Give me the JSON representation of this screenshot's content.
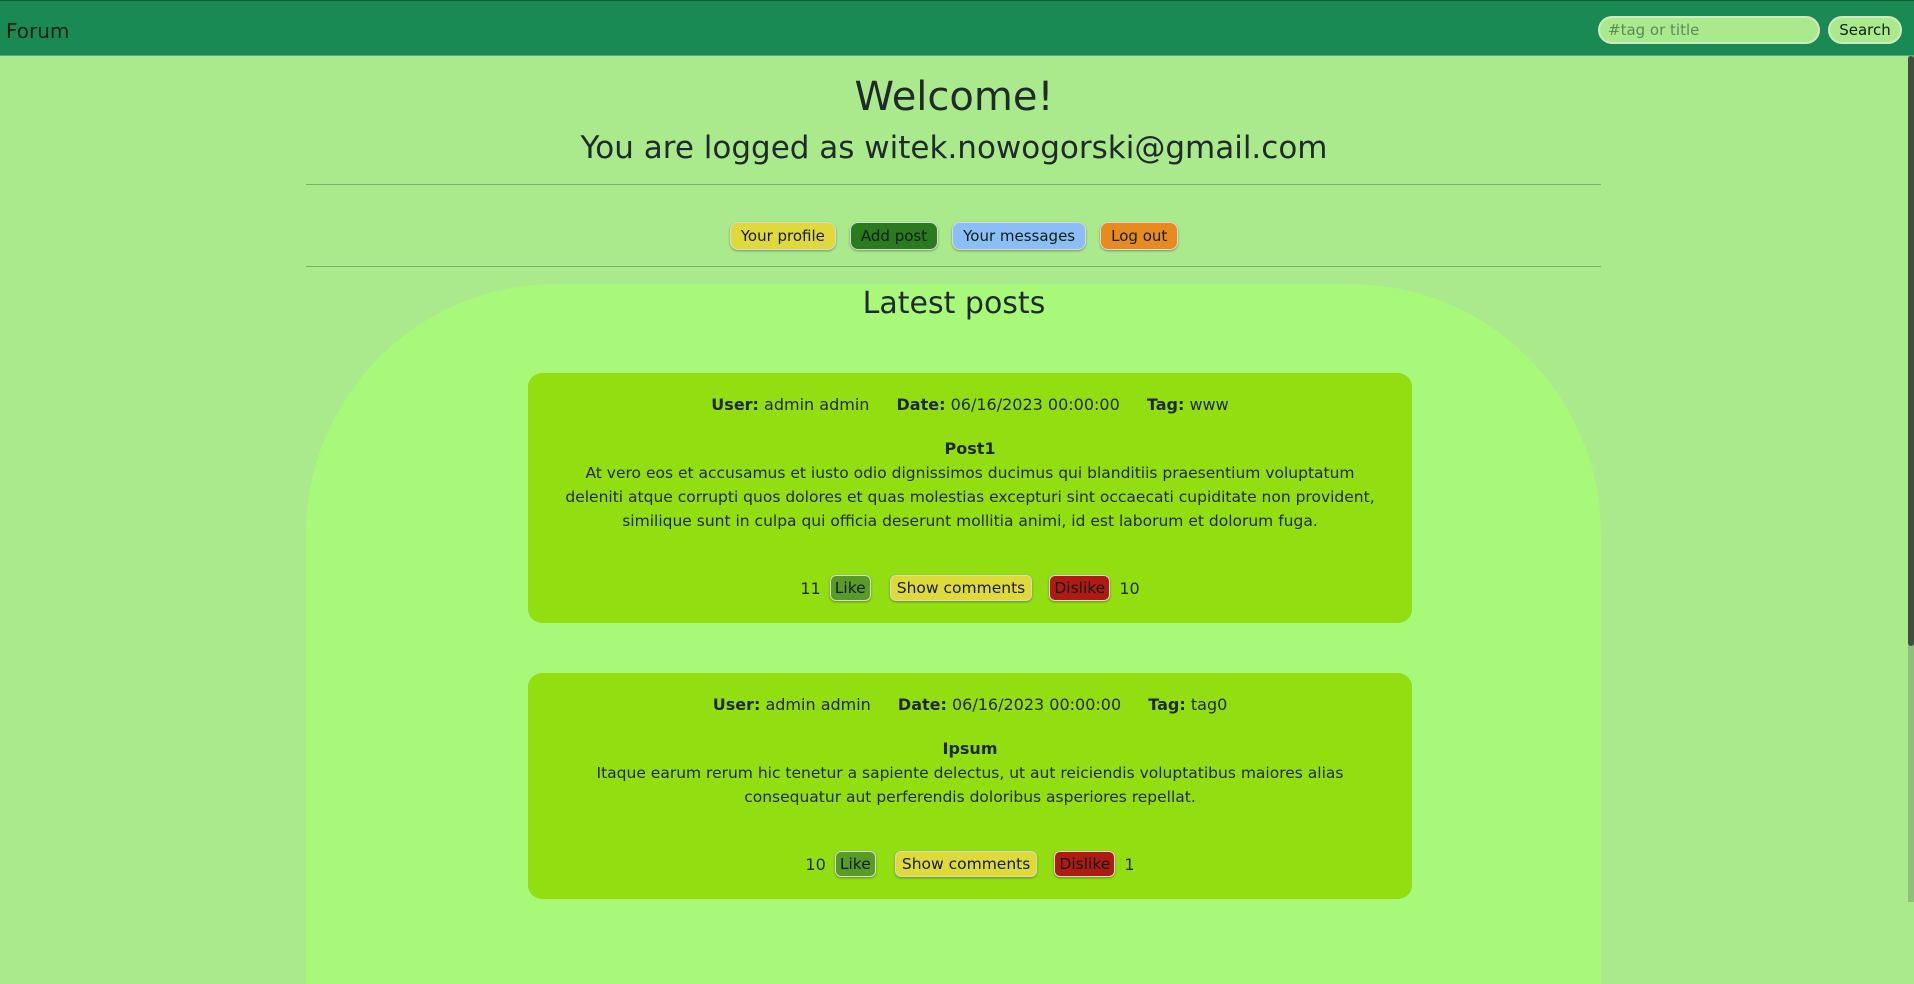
{
  "header": {
    "brand": "Forum",
    "search_placeholder": "#tag or title",
    "search_label": "Search"
  },
  "welcome": {
    "title": "Welcome!",
    "logged_as": "You are logged as witek.nowogorski@gmail.com"
  },
  "nav": {
    "profile": "Your profile",
    "add_post": "Add post",
    "messages": "Your messages",
    "logout": "Log out"
  },
  "latest_title": "Latest posts",
  "labels": {
    "user": "User:",
    "date": "Date:",
    "tag": "Tag:",
    "like": "Like",
    "show_comments": "Show comments",
    "dislike": "Dislike"
  },
  "posts": [
    {
      "user": "admin admin",
      "date": "06/16/2023 00:00:00",
      "tag": "www",
      "title": "Post1",
      "body": "At vero eos et accusamus et iusto odio dignissimos ducimus qui blanditiis praesentium voluptatum deleniti atque corrupti quos dolores et quas molestias excepturi sint occaecati cupiditate non provident, similique sunt in culpa qui officia deserunt mollitia animi, id est laborum et dolorum fuga.",
      "likes": "11",
      "dislikes": "10"
    },
    {
      "user": "admin admin",
      "date": "06/16/2023 00:00:00",
      "tag": "tag0",
      "title": "Ipsum",
      "body": "Itaque earum rerum hic tenetur a sapiente delectus, ut aut reiciendis voluptatibus maiores alias consequatur aut perferendis doloribus asperiores repellat.",
      "likes": "10",
      "dislikes": "1"
    }
  ]
}
